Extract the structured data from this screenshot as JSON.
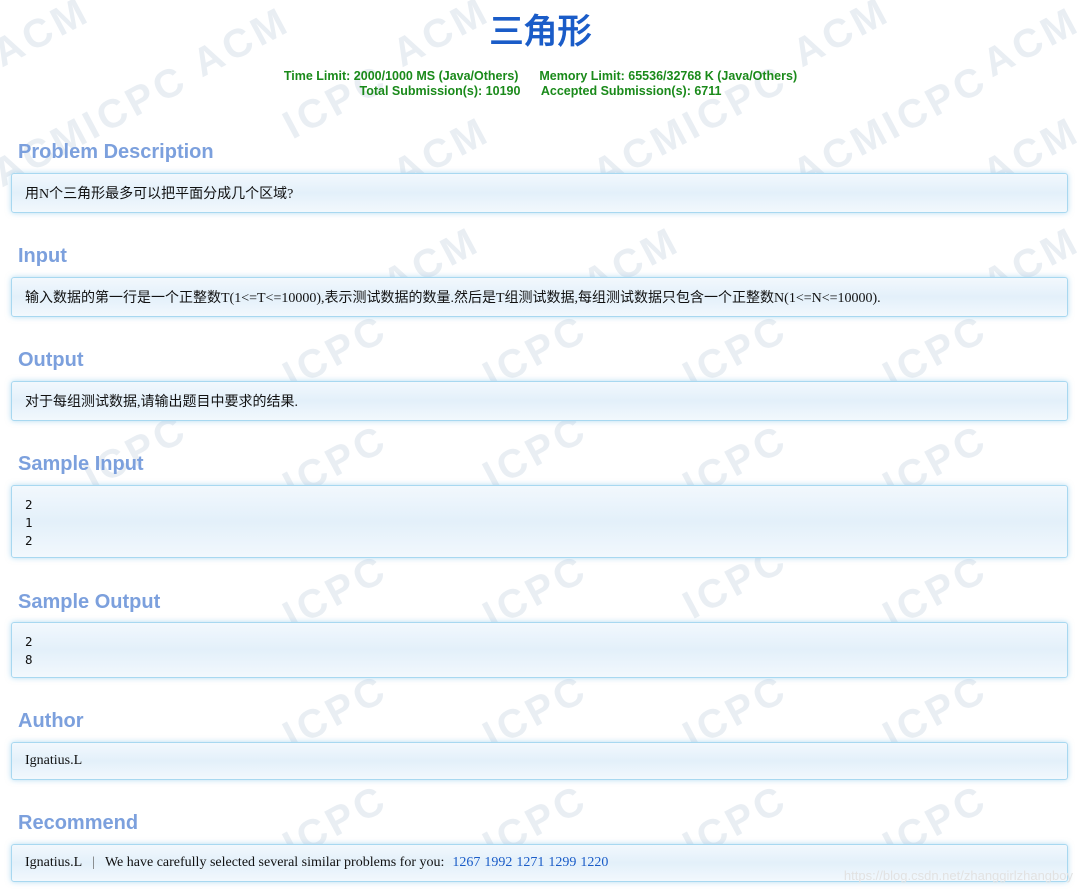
{
  "page_title": "三角形",
  "limits": {
    "time_limit": "Time Limit: 2000/1000 MS (Java/Others)",
    "memory_limit": "Memory Limit: 65536/32768 K (Java/Others)",
    "total_submissions": "Total Submission(s): 10190",
    "accepted_submissions": "Accepted Submission(s): 6711"
  },
  "sections": {
    "problem_description": {
      "title": "Problem Description",
      "body": "用N个三角形最多可以把平面分成几个区域?"
    },
    "input": {
      "title": "Input",
      "body": "输入数据的第一行是一个正整数T(1<=T<=10000),表示测试数据的数量.然后是T组测试数据,每组测试数据只包含一个正整数N(1<=N<=10000)."
    },
    "output": {
      "title": "Output",
      "body": "对于每组测试数据,请输出题目中要求的结果."
    },
    "sample_input": {
      "title": "Sample Input",
      "body": "2\n1\n2"
    },
    "sample_output": {
      "title": "Sample Output",
      "body": "2\n8"
    },
    "author": {
      "title": "Author",
      "body": "Ignatius.L"
    },
    "recommend": {
      "title": "Recommend",
      "recommender": "Ignatius.L",
      "separator": "|",
      "note": "We have carefully selected several similar problems for you:",
      "problems": [
        "1267",
        "1992",
        "1271",
        "1299",
        "1220"
      ]
    }
  },
  "watermark": {
    "text_acm": "ACM",
    "text_icpc": "ICPC"
  },
  "csdn_watermark": "https://blog.csdn.net/zhanggirlzhangboy",
  "colors": {
    "title": "#1a5cc8",
    "limits": "#1a8a1a",
    "section_title": "#7ca0dd",
    "panel_border": "#a8d8f0",
    "link": "#1a5cc8"
  }
}
